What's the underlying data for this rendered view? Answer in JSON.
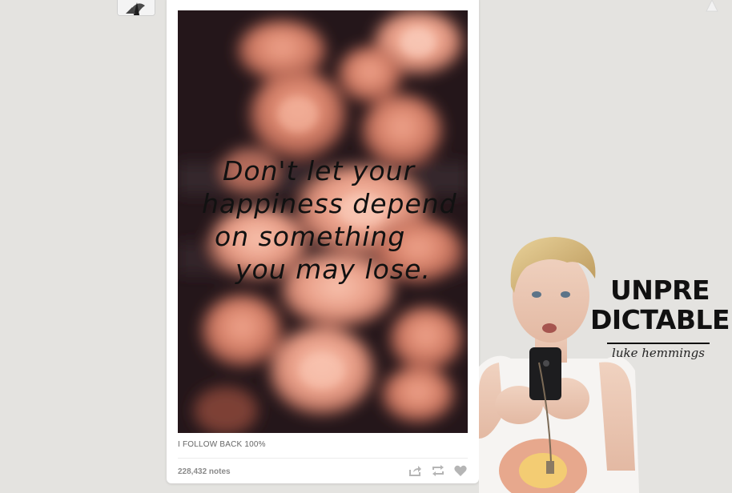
{
  "post": {
    "quote_lines": [
      "Don't let your",
      "happiness depend",
      "on something",
      "you may lose."
    ],
    "caption": "I FOLLOW BACK 100%",
    "notes": "228,432 notes",
    "actions": [
      "share-icon",
      "reblog-icon",
      "like-icon"
    ]
  },
  "sidebar_promo": {
    "title_line1": "UNPRE",
    "title_line2": "DICTABLE",
    "subtitle": "luke hemmings"
  },
  "colors": {
    "background": "#e4e3e0",
    "card": "#ffffff",
    "action_icon": "#b5b5b5"
  }
}
